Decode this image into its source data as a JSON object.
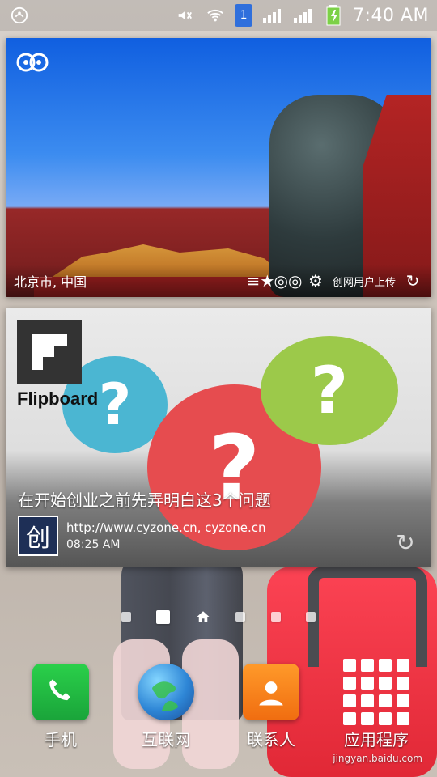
{
  "status_bar": {
    "time": "7:40 AM",
    "sim_number": "1"
  },
  "tripadvisor_widget": {
    "location": "北京市, 中国",
    "uploader_text": "创网用户上传"
  },
  "flipboard_widget": {
    "brand": "Flipboard",
    "headline": "在开始创业之前先弄明白这3个问题",
    "source_url": "http://www.cyzone.cn, cyzone.cn",
    "source_time": "08:25 AM",
    "source_avatar_char": "创"
  },
  "dock": {
    "items": [
      {
        "label": "手机",
        "icon": "phone-icon"
      },
      {
        "label": "互联网",
        "icon": "globe-icon"
      },
      {
        "label": "联系人",
        "icon": "contacts-icon"
      },
      {
        "label": "应用程序",
        "icon": "apps-icon"
      }
    ]
  },
  "watermark": {
    "domain": "jingyan.baidu.com"
  }
}
